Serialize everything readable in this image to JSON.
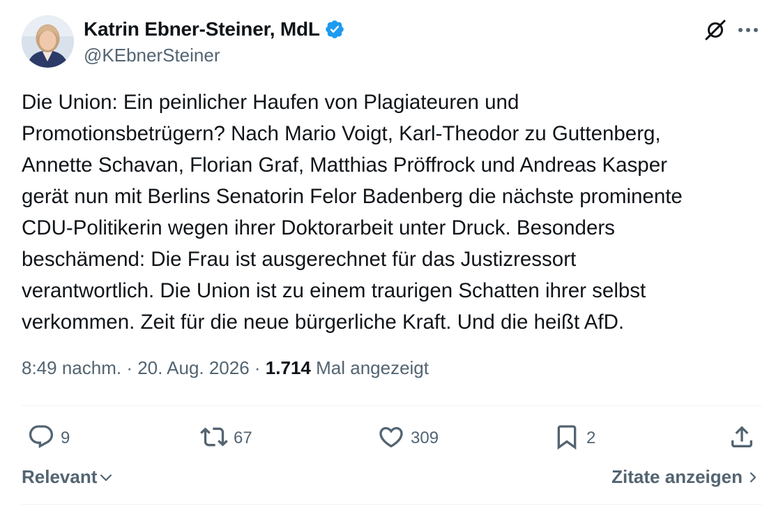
{
  "author": {
    "name": "Katrin Ebner-Steiner, MdL",
    "handle": "@KEbnerSteiner",
    "verified_color": "#1d9bf0"
  },
  "tweet": {
    "lines": [
      "Die Union: Ein peinlicher Haufen von Plagiateuren und",
      "Promotionsbetrügern? Nach Mario Voigt, Karl-Theodor zu Guttenberg,",
      "Annette Schavan, Florian Graf, Matthias Pröffrock und Andreas Kasper",
      "gerät nun mit Berlins Senatorin Felor Badenberg die nächste prominente",
      "CDU-Politikerin wegen ihrer Doktorarbeit unter Druck. Besonders",
      "beschämend: Die Frau ist ausgerechnet für das Justizressort",
      "verantwortlich. Die Union ist zu einem traurigen Schatten ihrer selbst",
      "verkommen. Zeit für die neue bürgerliche Kraft. Und die heißt AfD."
    ]
  },
  "meta": {
    "time": "8:49 nachm.",
    "separator": " · ",
    "date": "20. Aug. 2026",
    "views_count": "1.714",
    "views_label": "Mal angezeigt"
  },
  "actions": {
    "replies": "9",
    "reposts": "67",
    "likes": "309",
    "bookmarks": "2"
  },
  "footer": {
    "sort_label": "Relevant",
    "quotes_label": "Zitate anzeigen"
  },
  "icons": {
    "verified": "verified-badge-icon",
    "grok": "grok-icon",
    "more": "more-icon",
    "reply": "reply-icon",
    "repost": "repost-icon",
    "like": "heart-icon",
    "bookmark": "bookmark-icon",
    "share": "share-icon",
    "sort_chevron": "chevron-down-icon",
    "quotes_chevron": "chevron-right-icon"
  },
  "colors": {
    "text": "#0f1419",
    "secondary": "#536471",
    "divider": "#eff3f4",
    "accent": "#1d9bf0"
  }
}
